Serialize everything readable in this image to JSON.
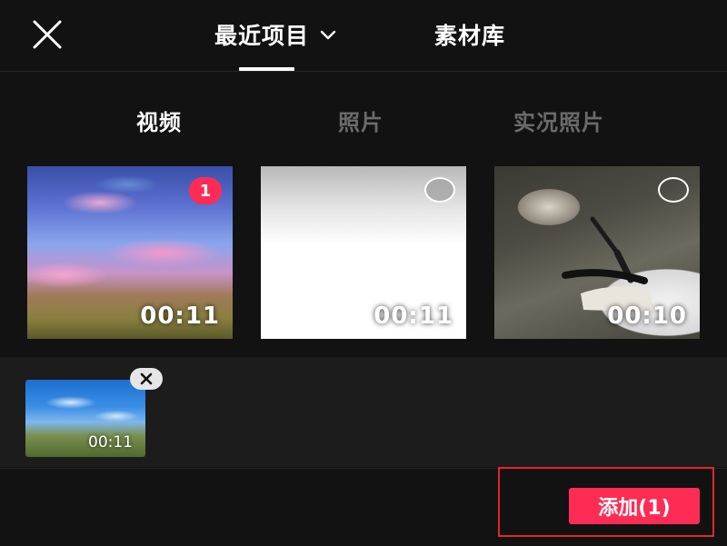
{
  "header": {
    "close_icon": "close-icon",
    "tabs": [
      {
        "label": "最近项目",
        "active": true,
        "icon": "chevron-down-icon"
      },
      {
        "label": "素材库",
        "active": false
      }
    ]
  },
  "filters": [
    {
      "label": "视频",
      "active": true
    },
    {
      "label": "照片",
      "active": false
    },
    {
      "label": "实况照片",
      "active": false
    }
  ],
  "media": [
    {
      "duration": "00:11",
      "selected": true,
      "selection_index": "1"
    },
    {
      "duration": "00:11",
      "selected": false
    },
    {
      "duration": "00:10",
      "selected": false
    }
  ],
  "selected_strip": {
    "items": [
      {
        "duration": "00:11",
        "remove_icon": "close-icon"
      }
    ]
  },
  "footer": {
    "add_button_label": "添加(1)",
    "accent_color": "#fe2c55",
    "highlight_color": "#e3262b"
  }
}
